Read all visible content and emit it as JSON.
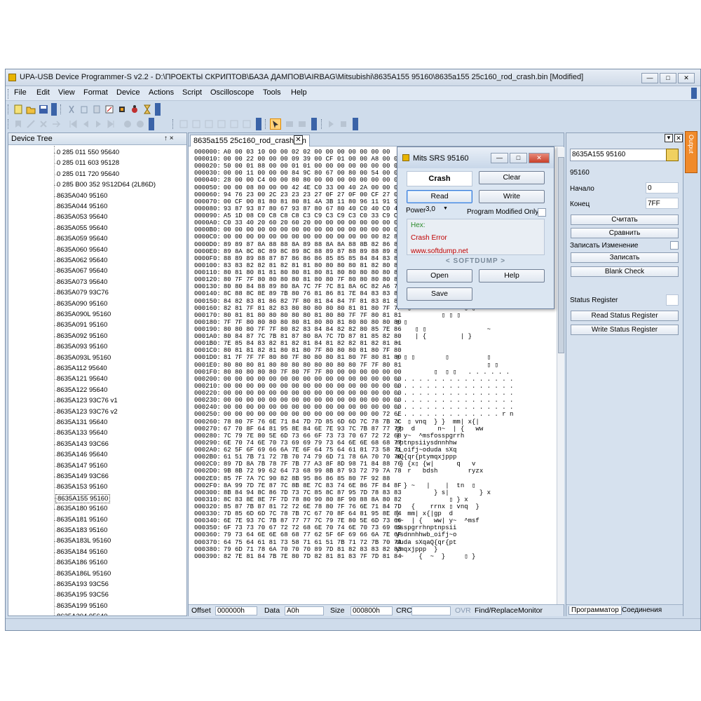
{
  "window": {
    "title": "UPA-USB Device Programmer-S v2.2 - D:\\ПРОЕКТЫ СКРИПТОВ\\БАЗА ДАМПОВ\\AIRBAG\\Mitsubishi\\8635A155 95160\\8635a155 25c160_rod_crash.bin [Modified]"
  },
  "menu": [
    "File",
    "Edit",
    "View",
    "Format",
    "Device",
    "Actions",
    "Script",
    "Oscilloscope",
    "Tools",
    "Help"
  ],
  "device_tree": {
    "title": "Device Tree",
    "pin": "↑ ×",
    "selected": "8635A155 95160",
    "items": [
      "0 285 011 550 95640",
      "0 285 011 603 95128",
      "0 285 011 720 95640",
      "0 285 B00 352 9S12D64 (2L86D)",
      "8635A040 95160",
      "8635A044 95160",
      "8635A053 95640",
      "8635A055 95640",
      "8635A059 95640",
      "8635A060 95640",
      "8635A062 95640",
      "8635A067 95640",
      "8635A073 95640",
      "8635A079 93C76",
      "8635A090 95160",
      "8635A090L 95160",
      "8635A091 95160",
      "8635A092 95160",
      "8635A093 95160",
      "8635A093L 95160",
      "8635A112 95640",
      "8635A121 95640",
      "8635A122 95640",
      "8635A123 93C76 v1",
      "8635A123 93C76 v2",
      "8635A131 95640",
      "8635A133 95640",
      "8635A143 93C66",
      "8635A146 95640",
      "8635A147 95160",
      "8635A149 93C66",
      "8635A153 95160",
      "8635A155 95160",
      "8635A180 95160",
      "8635A181 95160",
      "8635A183 95160",
      "8635A183L 95160",
      "8635A184 95160",
      "8635A186 95160",
      "8635A186L 95160",
      "8635A193 93C56",
      "8635A195 93C56",
      "8635A199 95160",
      "8635A204 95640"
    ]
  },
  "editor": {
    "tab": "8635a155 25c160_rod_crash.bin",
    "rows": [
      [
        "000000:",
        "A0 00 03 10 00 00 02 02 00 00 00 00 00 00 00",
        ""
      ],
      [
        "000010:",
        "00 00 22 00 00 00 09 39 00 CF 01 00 00 A8 00 00",
        ""
      ],
      [
        "000020:",
        "50 00 01 88 00 00 01 01 00 00 00 00 00 00 00 00",
        "P"
      ],
      [
        "000030:",
        "00 00 11 00 00 00 84 9C 80 67 00 80 00 54 00 00",
        ""
      ],
      [
        "000040:",
        "28 00 00 C4 00 00 80 80 00 00 00 00 00 00 00 00",
        "("
      ],
      [
        "000050:",
        "00 00 08 80 00 00 42 4E C0 33 00 40 2A 00 00 00",
        ""
      ],
      [
        "000060:",
        "94 76 23 00 2C 23 23 23 27 0F 27 0F 00 CF 27 0F",
        ""
      ],
      [
        "000070:",
        "00 CF 00 81 80 81 80 81 4A 3B 11 80 96 11 91 91",
        ""
      ],
      [
        "000080:",
        "93 87 93 87 80 67 93 87 80 67 80 40 C0 40 C0 40",
        ""
      ],
      [
        "000090:",
        "A5 1D 08 C0 C8 C8 C8 C3 C9 C3 C9 C3 C0 33 C9 C3",
        ""
      ],
      [
        "0000A0:",
        "C0 33 40 20 60 20 60 20 00 00 00 00 00 00 00 00",
        ""
      ],
      [
        "0000B0:",
        "00 00 00 00 00 00 00 00 00 00 00 00 00 00 00 00",
        ""
      ],
      [
        "0000C0:",
        "00 00 00 00 00 00 00 00 00 00 00 00 00 00 82 88",
        ""
      ],
      [
        "0000D0:",
        "89 89 87 8A 88 88 8A 89 88 8A 8A 88 8B 82 86 86",
        ""
      ],
      [
        "0000E0:",
        "89 8A 8C 8C 89 8C 89 8C 88 89 87 88 89 88 89 87",
        ""
      ],
      [
        "0000F0:",
        "88 89 89 88 87 87 86 86 86 85 85 85 84 84 83 84",
        ""
      ],
      [
        "000100:",
        "83 83 82 82 81 82 81 81 80 80 80 80 81 82 80 80",
        ""
      ],
      [
        "000110:",
        "80 81 80 81 81 80 80 81 80 81 80 80 80 80 80 80",
        ""
      ],
      [
        "000120:",
        "80 7F 7F 80 80 80 80 81 80 80 7F 80 80 80 80 80",
        ""
      ],
      [
        "000130:",
        "80 80 84 88 89 80 8A 7C 7F 7C 81 8A 6C 82 A6 76",
        ""
      ],
      [
        "000140:",
        "8C 88 8C 8E 89 7B 80 76 81 86 81 7E 84 83 83 82",
        ""
      ],
      [
        "000150:",
        "84 82 83 81 86 82 7F 80 81 84 84 7F 81 83 81 82",
        "              ▯            ▯"
      ],
      [
        "000160:",
        "82 81 7F 81 82 83 80 80 80 80 80 81 81 80 7F 7F",
        "   ▯              ▯ ▯"
      ],
      [
        "000170:",
        "80 81 81 80 80 80 80 80 81 80 80 7F 7F 80 81 81",
        "            ▯ ▯ ▯"
      ],
      [
        "000180:",
        "7F 7F 80 80 80 80 80 81 80 80 81 80 80 80 80 80",
        "▯ ▯"
      ],
      [
        "000190:",
        "80 80 80 7F 7F 80 82 83 84 84 82 82 80 85 7E 86",
        "     ▯ ▯                ~"
      ],
      [
        "0001A0:",
        "80 84 87 7C 7B 81 87 80 8A 7C 7D 87 81 85 82 80",
        "     | {         | }"
      ],
      [
        "0001B0:",
        "7E 85 84 83 82 81 82 81 84 81 82 82 81 82 81 81",
        "~"
      ],
      [
        "0001C0:",
        "80 81 81 82 81 80 81 80 7F 80 80 80 81 80 7F 80",
        ""
      ],
      [
        "0001D0:",
        "81 7F 7F 7F 80 80 7F 80 80 80 81 80 7F 80 81 80",
        "▯ ▯ ▯        ▯          ▯"
      ],
      [
        "0001E0:",
        "80 80 80 81 80 80 80 80 80 80 80 80 7F 7F 80 81",
        "                        ▯ ▯"
      ],
      [
        "0001F0:",
        "80 80 80 80 80 7F 80 7F 7F 80 00 00 00 00 00 00",
        "          ▯  ▯ ▯   . . . . . ."
      ],
      [
        "000200:",
        "00 00 00 00 00 00 00 00 00 00 00 00 00 00 00 00",
        ". . . . . . . . . . . . . . . ."
      ],
      [
        "000210:",
        "00 00 00 00 00 00 00 00 00 00 00 00 00 00 00 00",
        ". . . . . . . . . . . . . . . ."
      ],
      [
        "000220:",
        "00 00 00 00 00 00 00 00 00 00 00 00 00 00 00 00",
        ". . . . . . . . . . . . . . . ."
      ],
      [
        "000230:",
        "00 00 00 00 00 00 00 00 00 00 00 00 00 00 00 00",
        ". . . . . . . . . . . . . . . ."
      ],
      [
        "000240:",
        "00 00 00 00 00 00 00 00 00 00 00 00 00 00 00 00",
        ". . . . . . . . . . . . . . . ."
      ],
      [
        "000250:",
        "00 00 00 00 00 00 00 00 00 00 00 00 00 00 72 6E",
        ". . . . . . . . . . . . . . r n"
      ],
      [
        "000260:",
        "78 80 7F 76 6E 71 84 7D 7D 85 6D 6D 7C 78 7B 7C",
        "x  ▯ vnq  } }  mm| x{|"
      ],
      [
        "000270:",
        "67 70 8F 64 81 95 8E 84 6E 7E 93 7C 7B 87 77 77",
        "gp  d      n~  | {   ww"
      ],
      [
        "000280:",
        "7C 79 7E 80 5E 6D 73 66 6F 73 73 70 67 72 72 68",
        "| y~  ^msfosspgrrh"
      ],
      [
        "000290:",
        "6E 70 74 6E 70 73 69 69 79 73 64 6E 6E 68 68 77",
        "nptnpsiiysdnnhhw"
      ],
      [
        "0002A0:",
        "62 5F 6F 69 66 6A 7E 6F 64 75 64 61 81 73 58 71",
        "b_oifj~oduda sXq"
      ],
      [
        "0002B0:",
        "61 51 7B 71 72 7B 70 74 79 6D 71 78 6A 70 70 70",
        "aQ{qr{ptymqxjppp"
      ],
      [
        "0002C0:",
        "89 7D 8A 7B 78 7F 7B 77 A3 8F 8D 98 71 84 88 76",
        " } {x▯ {w|      q   v"
      ],
      [
        "0002D0:",
        "9B 8B 72 99 62 64 73 68 99 8B 87 93 72 79 7A 78",
        "   r   bdsh        ryzx"
      ],
      [
        "0002E0:",
        "85 7F 7A 7C 90 82 8B 95 86 86 85 80 7F 92 88",
        ""
      ],
      [
        "0002F0:",
        "8A 99 7D 7E 87 7C 8B 8E 7C 83 74 6E 86 7F 84 8F",
        "  } ~   |    |  tn  ▯"
      ],
      [
        "000300:",
        "8B 84 94 8C 86 7D 73 7C 85 8C 87 95 7D 78 83 83",
        "          } s|        } x"
      ],
      [
        "000310:",
        "8C 83 8E 8E 7F 7D 78 80 90 80 8F 90 88 8A 80 82",
        "              ▯ } x"
      ],
      [
        "000320:",
        "85 87 7B 87 81 72 72 6E 78 80 7F 76 6E 71 84 7D",
        "    {    rrnx ▯ vnq  }"
      ],
      [
        "000330:",
        "7D 85 6D 6D 7C 78 7B 7C 67 70 8F 64 81 95 8E 84",
        "}  mm| x{|gp  d"
      ],
      [
        "000340:",
        "6E 7E 93 7C 7B 87 77 77 7C 79 7E 80 5E 6D 73 66",
        "n~  | {   ww| y~  ^msf"
      ],
      [
        "000350:",
        "6F 73 73 70 67 72 72 68 6E 70 74 6E 70 73 69 69",
        "osspgrrhnptnpsii"
      ],
      [
        "000360:",
        "79 73 64 6E 6E 68 68 77 62 5F 6F 69 66 6A 7E 6F",
        "ysdnnhhwb_oifj~o"
      ],
      [
        "000370:",
        "64 75 64 61 81 73 58 71 61 51 7B 71 72 7B 70 74",
        "duda sXqaQ{qr{pt"
      ],
      [
        "000380:",
        "79 6D 71 78 6A 70 70 70 89 7D 81 82 83 83 82 83",
        "ymqxjppp  }"
      ],
      [
        "000390:",
        "82 7E 81 84 7B 7E 80 7D 82 81 81 83 7F 7D 81 84",
        " ~    {  ~  }     ▯ }"
      ]
    ],
    "status": {
      "offset_label": "Offset",
      "offset": "000000h",
      "data_label": "Data",
      "data": "A0h",
      "size_label": "Size",
      "size": "000800h",
      "crc_label": "CRC",
      "ovr": "OVR",
      "find": "Find/Replace",
      "monitor": "Monitor"
    }
  },
  "right_panel": {
    "device": "8635A155 95160",
    "chip": "95160",
    "start_label": "Начало",
    "start_value": "0",
    "end_label": "Конец",
    "end_value": "7FF",
    "read_button": "Считать",
    "compare_button": "Сравнить",
    "write_change_label": "Записать Изменение",
    "write_button": "Записать",
    "blank_check_button": "Blank Check",
    "status_register_label": "Status Register",
    "read_status_button": "Read Status Register",
    "write_status_button": "Write Status Register",
    "tab_programmer": "Программатор",
    "tab_connections": "Соединения",
    "output": "Output"
  },
  "dialog": {
    "title": "Mits SRS 95160",
    "crash_label": "Crash",
    "clear_button": "Clear",
    "read_button": "Read",
    "write_button": "Write",
    "power_label": "Power",
    "power_value": "3,0",
    "program_modified_label": "Program Modified Only",
    "hex_label": "Hex:",
    "crash_error": "Crash Error",
    "website": "www.softdump.net",
    "brand": "< SOFTDUMP >",
    "open_button": "Open",
    "help_button": "Help",
    "save_button": "Save"
  }
}
